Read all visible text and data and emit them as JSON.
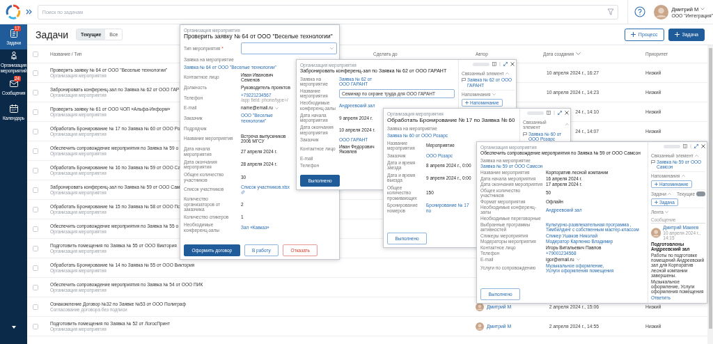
{
  "topbar": {
    "search": {
      "placeholder": "Поиск по задачам"
    },
    "user": {
      "name": "Дмитрий М",
      "org": "ООО \"Интеграция\""
    }
  },
  "nav": [
    {
      "label": "Задачи",
      "badge": "17",
      "selected": true
    },
    {
      "label": "Организация мероприятий",
      "selected": false
    },
    {
      "label": "Сообщения",
      "badge": "24",
      "selected": false
    },
    {
      "label": "Календарь",
      "selected": false
    }
  ],
  "page": {
    "title": "Задачи",
    "tabs": [
      {
        "label": "Текущие",
        "selected": true
      },
      {
        "label": "Все",
        "selected": false
      }
    ],
    "buttons": [
      {
        "label": "Процесс",
        "kind": "outline"
      },
      {
        "label": "Задача",
        "kind": "primary"
      }
    ]
  },
  "table": {
    "all_checked": false,
    "columns": [
      {
        "label": "Название / Тип",
        "sorted": false
      },
      {
        "label": "Сделать до",
        "sorted": false
      },
      {
        "label": "Автор",
        "sorted": false
      },
      {
        "label": "Дата создания",
        "sorted": true
      },
      {
        "label": "Приоритет",
        "sorted": false
      }
    ],
    "rows": [
      {
        "checked": false,
        "title": "Проверить заявку № 64 от ООО \"Веселые технологии\"",
        "type": "Организация мероприятия",
        "created": "10 апреля 2024 г., 16:27",
        "priority": "Низкий"
      },
      {
        "checked": false,
        "title": "Забронировать конференц-зал по Заявка № 62 от ООО ГАР",
        "type": "Организация мероприятия",
        "created": "10 апреля 2024 г., 14:23",
        "priority": "Низкий"
      },
      {
        "checked": false,
        "title": "Проверить заявку № 61 от ООО ЧОП «Альфа-Информ»",
        "type": "Организация мероприятия",
        "created": "24 г., 14:10",
        "priority": "Низкий"
      },
      {
        "checked": false,
        "title": "Обработать Бронирование № 17 по Заявка № 60 от ООО Ро",
        "type": "Организация мероприятия",
        "created": "24 г., 14:07",
        "priority": "Низкий"
      },
      {
        "checked": false,
        "title": "Обеспечить сопровождение мероприятия по Заявка № 59 о",
        "type": "Организация мероприятия"
      },
      {
        "checked": false,
        "title": "Обработать Бронирование № 16 по Заявка № 59 от ООО Са",
        "type": "Организация мероприятия"
      },
      {
        "checked": false,
        "title": "Забронировать конференц-зал по Заявка № 59 от ООО Сам",
        "type": "Организация мероприятия"
      },
      {
        "checked": false,
        "title": "Обработать Бронирование № 15 по Заявка № 58 от ООО По",
        "type": "Организация мероприятия"
      },
      {
        "checked": false,
        "title": "Обеспечить сопровождение мероприятия по Заявка № 55 о",
        "type": "Организация мероприятия"
      },
      {
        "checked": false,
        "title": "Подготовить помещения по Заявка № 55 от ООО Виктория",
        "type": "Организация мероприятия"
      },
      {
        "checked": false,
        "title": "Обработать Бронирование № 14 по Заявка № 55 от ООО Виктория",
        "type": "Организация мероприятия"
      },
      {
        "checked": false,
        "title": "Обеспечить сопровождение мероприятия по Заявка № 54 от ООО ПИК",
        "type": "Организация мероприятия"
      },
      {
        "checked": false,
        "title": "Ознакомление Договор №32 по Заявке №53 от ООО Полиграф",
        "type": "Согласование договора без подписи",
        "author": "Дмитрий М",
        "created": "2 апреля 2024 г., 15:06",
        "priority": "Низкий"
      },
      {
        "checked": false,
        "title": "Подготовить помещения по Заявка № 52 от ЛогосПринт",
        "type": "Организация мероприятия",
        "author": "Дмитрий М",
        "created": "2 апреля 2024 г., 14:55",
        "priority": "Низкий"
      }
    ]
  },
  "popups": [
    {
      "category": "Организация мероприятия",
      "title": "Проверить заявку № 64 от ООО \"Веселые технологии\"",
      "window_controls": false,
      "fields": [
        {
          "kind": "select",
          "label": "Тип мероприятия",
          "mark": "*"
        },
        {
          "kind": "section",
          "label": "Заявка на мероприятие"
        },
        {
          "kind": "request-link",
          "value": "Заявка № 64 от ООО \"Веселые технологии\""
        },
        {
          "kind": "text",
          "label": "Контактное лицо",
          "value": "Иван Иванович Семенов"
        },
        {
          "kind": "text",
          "label": "Должность",
          "value": "Руководитель проектов"
        },
        {
          "kind": "link",
          "label": "Телефон",
          "value": "+79221234567",
          "note": "/app field: phone/type=/"
        },
        {
          "kind": "text",
          "label": "E-mail",
          "value": "name@email.ru",
          "dropdown": true
        },
        {
          "kind": "link",
          "label": "Заказчик",
          "value": "ООО \"Веселые технологии\""
        },
        {
          "kind": "empty",
          "label": "Подрядчик"
        },
        {
          "kind": "text",
          "label": "Название мероприятия",
          "value": "Встреча выпускников 2006 МГСУ"
        },
        {
          "kind": "text",
          "label": "Дата начала мероприятия",
          "value": "27 апреля 2024 г."
        },
        {
          "kind": "text",
          "label": "Дата окончания мероприятия",
          "value": "28 апреля 2024 г."
        },
        {
          "kind": "text",
          "label": "Общее количество участников",
          "value": "30"
        },
        {
          "kind": "file",
          "label": "Список участников",
          "value": "Список участников.xlsx"
        },
        {
          "kind": "text",
          "label": "Количество организаторов от заказчика",
          "value": "2"
        },
        {
          "kind": "text",
          "label": "Количество спикеров",
          "value": "1"
        },
        {
          "kind": "link",
          "label": "Необходимые конференц-залы",
          "value": "Зал «Кавказ»"
        }
      ],
      "buttons": [
        {
          "label": "Оформить договор",
          "kind": "primary"
        },
        {
          "label": "В работу",
          "kind": "outline"
        },
        {
          "label": "Отказать",
          "kind": "danger"
        }
      ]
    },
    {
      "category": "Организация мероприятия",
      "title": "Забронировать конференц-зал по Заявка № 62 от ООО ГАРАНТ",
      "window_controls": true,
      "fields": [
        {
          "kind": "link",
          "label": "Заявка на мероприятие",
          "value": "Заявка № 62 от ООО ГАРАНТ"
        },
        {
          "kind": "input",
          "label": "Название мероприятия",
          "value": "Семинар по охране труда для ООО ГАРАНТ"
        },
        {
          "kind": "link",
          "label": "Необходимые конференц-залы",
          "value": "Андреевский зал"
        },
        {
          "kind": "text",
          "label": "Дата начала мероприятия",
          "value": "9 апреля 2024 г."
        },
        {
          "kind": "text",
          "label": "Дата окончания мероприятия",
          "value": "10 апреля 2024 г."
        },
        {
          "kind": "link",
          "label": "Заказчик",
          "value": "ООО ГАРАНТ"
        },
        {
          "kind": "text",
          "label": "Контактное лицо",
          "value": "Иван Федорович Яковлев"
        },
        {
          "kind": "empty",
          "label": "E-mail"
        },
        {
          "kind": "empty",
          "label": "Телефон"
        }
      ],
      "buttons": [
        {
          "label": "Выполнено",
          "kind": "primary"
        }
      ],
      "sidebar": [
        {
          "kind": "heading",
          "label": "Связанный элемент",
          "expanded": true
        },
        {
          "kind": "related",
          "label": "Заявка № 62 от ООО ГАРАНТ"
        },
        {
          "kind": "heading",
          "label": "Напоминания",
          "expanded": false
        },
        {
          "kind": "add",
          "label": "Напоминание"
        }
      ]
    },
    {
      "category": "Организация мероприятия",
      "title": "Обработать Бронирование № 17 по Заявка № 60",
      "window_controls": true,
      "fields": [
        {
          "kind": "section",
          "label": "Заявка на мероприятие"
        },
        {
          "kind": "request-link",
          "value": "Заявка № 60 от ООО Розарс"
        },
        {
          "kind": "text",
          "label": "Название мероприятия",
          "value": "Мероприятие"
        },
        {
          "kind": "link",
          "label": "Заказчик",
          "value": "ООО Розарс"
        },
        {
          "kind": "text",
          "label": "Дата и время заезда",
          "value": "8 апреля 2024 г., 0:00"
        },
        {
          "kind": "text",
          "label": "Дата и время выезда",
          "value": "9 апреля 2024 г., 0:00"
        },
        {
          "kind": "text",
          "label": "Общее количество проживающих",
          "value": "150"
        },
        {
          "kind": "outer-link",
          "label": "Бронирование номеров",
          "value": "Бронирование № 17 по"
        }
      ],
      "buttons": [
        {
          "label": "Выполнено",
          "kind": "outline"
        }
      ],
      "sidebar": [
        {
          "kind": "heading",
          "label": "Связанный элемент",
          "expanded": true
        },
        {
          "kind": "related",
          "label": "Заявка № 60 от ООО Розарс"
        }
      ]
    },
    {
      "category": "Организация мероприятия",
      "title": "Обеспечить сопровождение мероприятия по Заявка № 59 от ООО Самсон",
      "window_controls": true,
      "fields": [
        {
          "kind": "section",
          "label": "Заявка на мероприятие"
        },
        {
          "kind": "request-link",
          "value": "Заявка № 59 от ООО Самсон"
        },
        {
          "kind": "text",
          "label": "Название мероприятия",
          "value": "Корпоратив лесной компании"
        },
        {
          "kind": "text",
          "label": "Дата начала мероприятия",
          "value": "16 апреля 2024 г."
        },
        {
          "kind": "text",
          "label": "Дата окончания мероприятия",
          "value": "17 апреля 2024 г."
        },
        {
          "kind": "text",
          "label": "Общее количество участников",
          "value": "50"
        },
        {
          "kind": "text",
          "label": "Формат мероприятия",
          "value": "Офлайн"
        },
        {
          "kind": "link",
          "label": "Необходимые конференц-залы",
          "value": "Андреевский зал"
        },
        {
          "kind": "empty",
          "label": "Необходимые переговорные"
        },
        {
          "kind": "links",
          "label": "Выбранные программы активностей",
          "values": [
            "Культурно-развлекательная программа ,",
            "Тимбилдинг с собственным мастер-классом"
          ]
        },
        {
          "kind": "link",
          "label": "Спикеры мероприятия",
          "value": "Спикер Ушаков Николай"
        },
        {
          "kind": "link",
          "label": "Модераторы мероприятия",
          "value": "Модератор Карпенко Владимир"
        },
        {
          "kind": "text",
          "label": "Контактное лицо",
          "value": "Игорь Витальевич Павлов"
        },
        {
          "kind": "link",
          "label": "Телефон",
          "value": "+79001234568"
        },
        {
          "kind": "text",
          "label": "E-mail",
          "value": "igor@email.ru",
          "dropdown": true
        },
        {
          "kind": "outer-links",
          "label": "Услуги по сопровождению",
          "values": [
            "Музыкальное оформление,",
            "Услуги оформления помещения"
          ]
        }
      ],
      "buttons": [
        {
          "label": "Выполнено",
          "kind": "outline"
        }
      ],
      "sidebar": [
        {
          "kind": "heading",
          "label": "Связанный элемент",
          "expanded": true
        },
        {
          "kind": "related",
          "label": "Заявка № 59 от ООО Самсон"
        },
        {
          "kind": "heading",
          "label": "Напоминания",
          "expanded": true
        },
        {
          "kind": "add",
          "label": "Напоминание"
        },
        {
          "kind": "heading",
          "label": "Задачи",
          "expanded": true,
          "toggle": {
            "label": "Текущие",
            "on": true
          }
        },
        {
          "kind": "add",
          "label": "Задача"
        },
        {
          "kind": "heading",
          "label": "Лента",
          "expanded": false
        },
        {
          "kind": "comment",
          "placeholder": "Сообщение"
        },
        {
          "kind": "message",
          "author": "Дмитрий Макеев",
          "time": "10 апреля 2024 г., 14:15",
          "subject": "Подготовлены Андреевский зал",
          "text": "Работы по подготовке помещений Андреевский зал для Корпоратив лесной компании завершены.",
          "note": "Музыкальное оформление, Услуги оформления помещения",
          "reply": "Ответить"
        }
      ]
    }
  ]
}
